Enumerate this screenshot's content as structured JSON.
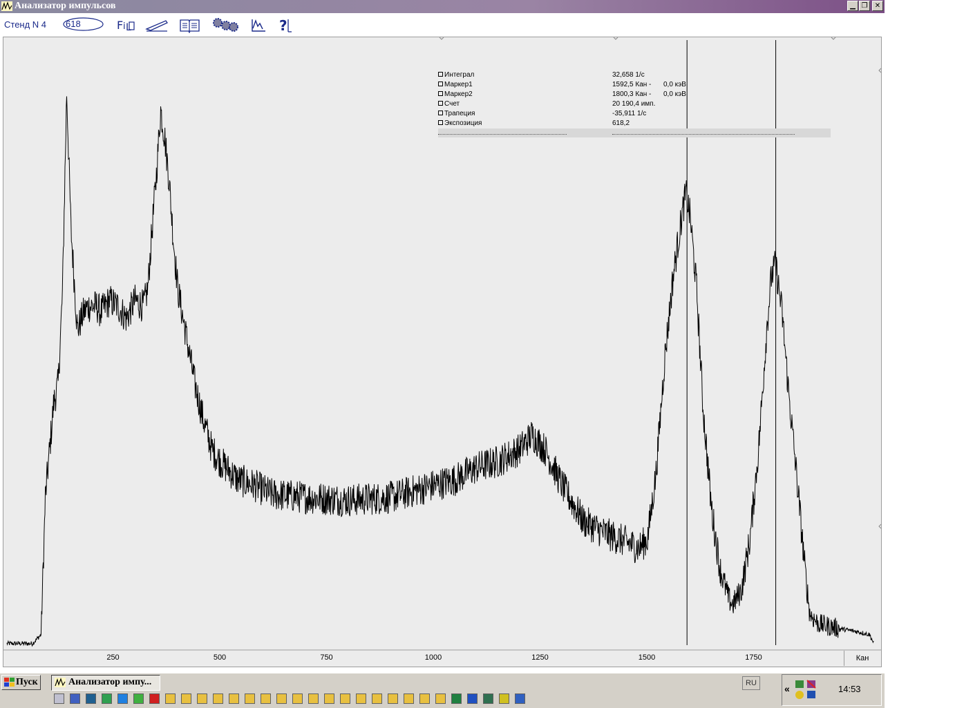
{
  "window": {
    "title": "Анализатор импульсов",
    "controls": [
      "minimize",
      "restore",
      "close"
    ]
  },
  "toolbar": {
    "stand_label": "Стенд N 4",
    "count_value": "618",
    "tools": [
      "file-icon",
      "pen-icon",
      "book-icon",
      "gears-icon",
      "chart-icon",
      "help-icon"
    ]
  },
  "info_panel": {
    "rows": [
      {
        "name": "Интеграл",
        "value": "32,658 1/с"
      },
      {
        "name": "Маркер1",
        "value": "1592,5 Кан -",
        "extra": "0,0 кэВ"
      },
      {
        "name": "Маркер2",
        "value": "1800,3 Кан -",
        "extra": "0,0 кэВ"
      },
      {
        "name": "Счет",
        "value": "20 190,4 имп."
      },
      {
        "name": "Трапеция",
        "value": "-35,911 1/с"
      },
      {
        "name": "Экспозиция",
        "value": "618,2"
      }
    ]
  },
  "chart_data": {
    "type": "line",
    "xlabel": "Кан",
    "ylabel": "",
    "title": "",
    "xlim": [
      0,
      2050
    ],
    "ylim": [
      0,
      1000
    ],
    "x_ticks": [
      250,
      500,
      750,
      1000,
      1250,
      1500,
      1750
    ],
    "x_tick_labels": [
      "250",
      "500",
      "750",
      "1000",
      "1250",
      "1500",
      "1750"
    ],
    "markers": [
      1592.5,
      1800.3
    ],
    "grid": false,
    "series": [
      {
        "profile_x": [
          0,
          60,
          80,
          90,
          100,
          110,
          120,
          130,
          140,
          150,
          165,
          180,
          190,
          200,
          210,
          220,
          240,
          260,
          280,
          300,
          320,
          330,
          340,
          350,
          360,
          370,
          380,
          390,
          400,
          420,
          440,
          460,
          480,
          500,
          540,
          580,
          620,
          700,
          800,
          900,
          1000,
          1050,
          1100,
          1150,
          1200,
          1230,
          1260,
          1300,
          1350,
          1400,
          1450,
          1480,
          1500,
          1520,
          1540,
          1560,
          1580,
          1590,
          1600,
          1615,
          1630,
          1650,
          1670,
          1690,
          1700,
          1720,
          1740,
          1760,
          1780,
          1790,
          1800,
          1815,
          1830,
          1850,
          1870,
          1880,
          1900,
          1950,
          1990,
          2020,
          2030
        ],
        "profile_y": [
          5,
          5,
          20,
          250,
          330,
          410,
          440,
          590,
          930,
          700,
          530,
          560,
          570,
          570,
          570,
          560,
          580,
          570,
          550,
          580,
          570,
          600,
          700,
          790,
          900,
          850,
          780,
          680,
          600,
          520,
          440,
          380,
          330,
          310,
          280,
          270,
          255,
          250,
          245,
          250,
          270,
          280,
          300,
          310,
          330,
          355,
          330,
          270,
          210,
          190,
          175,
          165,
          180,
          290,
          480,
          620,
          720,
          760,
          720,
          600,
          400,
          230,
          130,
          80,
          70,
          95,
          180,
          330,
          540,
          620,
          640,
          560,
          430,
          280,
          120,
          55,
          38,
          30,
          25,
          20,
          5
        ],
        "noise_amplitude": 28,
        "channels": 2030
      }
    ]
  },
  "taskbar": {
    "start_label": "Пуск",
    "task_label": "Анализатор импу...",
    "lang": "RU",
    "clock": "14:53",
    "chevron": "«"
  }
}
